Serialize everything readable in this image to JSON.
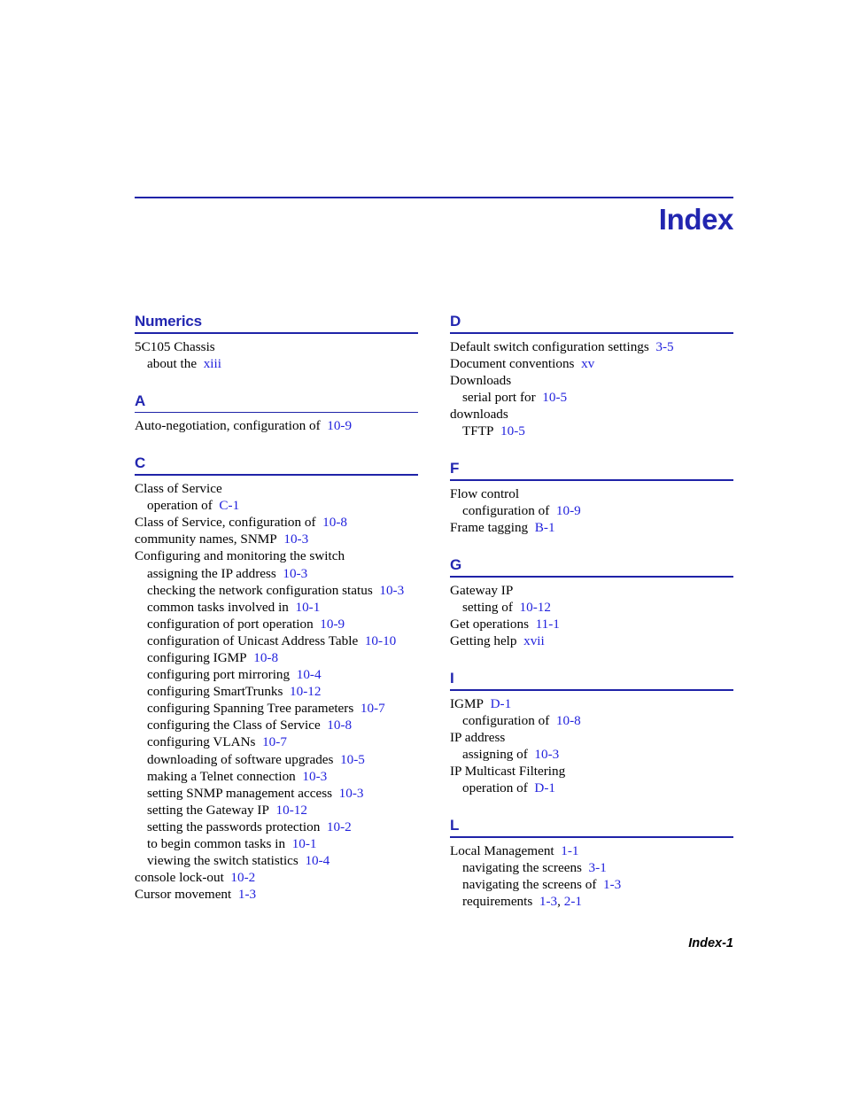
{
  "header": {
    "title": "Index"
  },
  "footer": {
    "page_label": "Index-1"
  },
  "colors": {
    "heading_blue": "#2226b0",
    "rule_blue": "#1f23a8",
    "link_blue": "#2222dd",
    "body_black": "#000000"
  },
  "columns": [
    {
      "name": "left-column",
      "sections": [
        {
          "letter": "Numerics",
          "entries": [
            {
              "level": 1,
              "text": "5C105 Chassis",
              "pages": []
            },
            {
              "level": 2,
              "text": "about the",
              "pages": [
                "xiii"
              ]
            }
          ]
        },
        {
          "letter": "A",
          "entries": [
            {
              "level": 1,
              "text": "Auto-negotiation, configuration of",
              "pages": [
                "10-9"
              ]
            }
          ]
        },
        {
          "letter": "C",
          "entries": [
            {
              "level": 1,
              "text": "Class of Service",
              "pages": []
            },
            {
              "level": 2,
              "text": "operation of",
              "pages": [
                "C-1"
              ]
            },
            {
              "level": 1,
              "text": "Class of Service, configuration of",
              "pages": [
                "10-8"
              ]
            },
            {
              "level": 1,
              "text": "community names, SNMP",
              "pages": [
                "10-3"
              ]
            },
            {
              "level": 1,
              "text": "Configuring and monitoring the switch",
              "pages": []
            },
            {
              "level": 2,
              "text": "assigning the IP address",
              "pages": [
                "10-3"
              ]
            },
            {
              "level": 2,
              "text": "checking the network configuration status",
              "pages": [
                "10-3"
              ]
            },
            {
              "level": 2,
              "text": "common tasks involved in",
              "pages": [
                "10-1"
              ]
            },
            {
              "level": 2,
              "text": "configuration of port operation",
              "pages": [
                "10-9"
              ]
            },
            {
              "level": 2,
              "text": "configuration of Unicast Address Table",
              "pages": [
                "10-10"
              ]
            },
            {
              "level": 2,
              "text": "configuring IGMP",
              "pages": [
                "10-8"
              ]
            },
            {
              "level": 2,
              "text": "configuring port mirroring",
              "pages": [
                "10-4"
              ]
            },
            {
              "level": 2,
              "text": "configuring SmartTrunks",
              "pages": [
                "10-12"
              ]
            },
            {
              "level": 2,
              "text": "configuring Spanning Tree parameters",
              "pages": [
                "10-7"
              ]
            },
            {
              "level": 2,
              "text": "configuring the Class of Service",
              "pages": [
                "10-8"
              ]
            },
            {
              "level": 2,
              "text": "configuring VLANs",
              "pages": [
                "10-7"
              ]
            },
            {
              "level": 2,
              "text": "downloading of software upgrades",
              "pages": [
                "10-5"
              ]
            },
            {
              "level": 2,
              "text": "making a Telnet connection",
              "pages": [
                "10-3"
              ]
            },
            {
              "level": 2,
              "text": "setting SNMP management access",
              "pages": [
                "10-3"
              ]
            },
            {
              "level": 2,
              "text": "setting the Gateway IP",
              "pages": [
                "10-12"
              ]
            },
            {
              "level": 2,
              "text": "setting the passwords protection",
              "pages": [
                "10-2"
              ]
            },
            {
              "level": 2,
              "text": "to begin common tasks in",
              "pages": [
                "10-1"
              ]
            },
            {
              "level": 2,
              "text": "viewing the switch statistics",
              "pages": [
                "10-4"
              ]
            },
            {
              "level": 1,
              "text": "console lock-out",
              "pages": [
                "10-2"
              ]
            },
            {
              "level": 1,
              "text": "Cursor movement",
              "pages": [
                "1-3"
              ]
            }
          ]
        }
      ]
    },
    {
      "name": "right-column",
      "sections": [
        {
          "letter": "D",
          "entries": [
            {
              "level": 1,
              "text": "Default switch configuration settings",
              "pages": [
                "3-5"
              ]
            },
            {
              "level": 1,
              "text": "Document conventions",
              "pages": [
                "xv"
              ]
            },
            {
              "level": 1,
              "text": "Downloads",
              "pages": []
            },
            {
              "level": 2,
              "text": "serial port for",
              "pages": [
                "10-5"
              ]
            },
            {
              "level": 1,
              "text": "downloads",
              "pages": []
            },
            {
              "level": 2,
              "text": "TFTP",
              "pages": [
                "10-5"
              ]
            }
          ]
        },
        {
          "letter": "F",
          "entries": [
            {
              "level": 1,
              "text": "Flow control",
              "pages": []
            },
            {
              "level": 2,
              "text": "configuration of",
              "pages": [
                "10-9"
              ]
            },
            {
              "level": 1,
              "text": "Frame tagging",
              "pages": [
                "B-1"
              ]
            }
          ]
        },
        {
          "letter": "G",
          "entries": [
            {
              "level": 1,
              "text": "Gateway IP",
              "pages": []
            },
            {
              "level": 2,
              "text": "setting of",
              "pages": [
                "10-12"
              ]
            },
            {
              "level": 1,
              "text": "Get operations",
              "pages": [
                "11-1"
              ]
            },
            {
              "level": 1,
              "text": "Getting help",
              "pages": [
                "xvii"
              ]
            }
          ]
        },
        {
          "letter": "I",
          "entries": [
            {
              "level": 1,
              "text": "IGMP",
              "pages": [
                "D-1"
              ]
            },
            {
              "level": 2,
              "text": "configuration of",
              "pages": [
                "10-8"
              ]
            },
            {
              "level": 1,
              "text": "IP address",
              "pages": []
            },
            {
              "level": 2,
              "text": "assigning of",
              "pages": [
                "10-3"
              ]
            },
            {
              "level": 1,
              "text": "IP Multicast Filtering",
              "pages": []
            },
            {
              "level": 2,
              "text": "operation of",
              "pages": [
                "D-1"
              ]
            }
          ]
        },
        {
          "letter": "L",
          "entries": [
            {
              "level": 1,
              "text": "Local Management",
              "pages": [
                "1-1"
              ]
            },
            {
              "level": 2,
              "text": "navigating the screens",
              "pages": [
                "3-1"
              ]
            },
            {
              "level": 2,
              "text": "navigating the screens of",
              "pages": [
                "1-3"
              ]
            },
            {
              "level": 2,
              "text": "requirements",
              "pages": [
                "1-3",
                "2-1"
              ]
            }
          ]
        }
      ]
    }
  ]
}
